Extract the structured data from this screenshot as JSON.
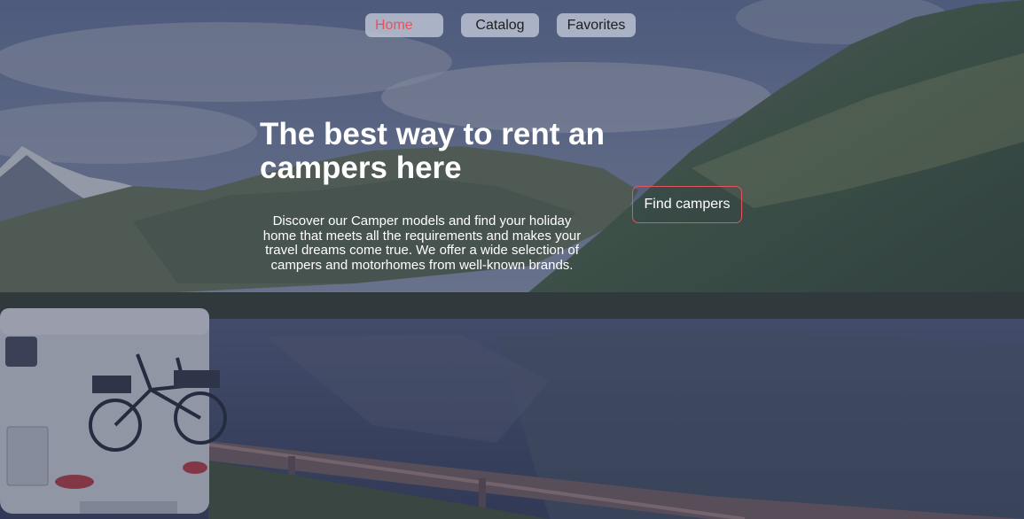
{
  "nav": {
    "items": [
      {
        "label": "Home",
        "active": true
      },
      {
        "label": "Catalog",
        "active": false
      },
      {
        "label": "Favorites",
        "active": false
      }
    ]
  },
  "hero": {
    "title": "The best way to rent an campers here",
    "description": "Discover our Camper models and find your holiday home that meets all the requirements and makes your travel dreams come true. We offer a wide selection of campers and motorhomes from well-known brands.",
    "cta_label": "Find campers"
  },
  "colors": {
    "accent": "#e4545f",
    "nav_bg": "#bec4d4",
    "overlay": "#1e223c"
  }
}
